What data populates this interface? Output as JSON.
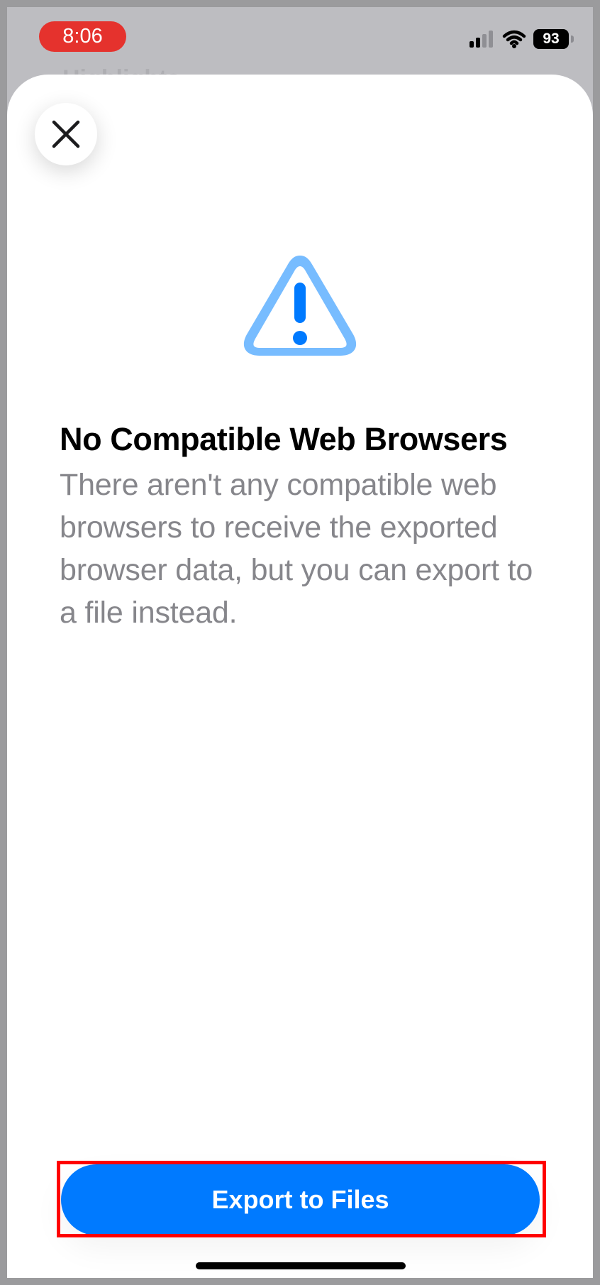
{
  "status_bar": {
    "time": "8:06",
    "battery_level": "93",
    "icons": [
      "signal-icon",
      "wifi-icon",
      "battery-icon"
    ]
  },
  "background": {
    "partial_title": "Highlights"
  },
  "sheet": {
    "close_icon": "close-icon",
    "warning_icon": "warning-triangle-icon",
    "title": "No Compatible Web Browsers",
    "description": "There aren't any compatible web browsers to receive the exported browser data, but you can export to a file instead.",
    "primary_button_label": "Export to Files"
  },
  "colors": {
    "accent": "#007AFF",
    "time_pill": "#E5322D",
    "warning_fill": "#77BCFF",
    "description_text": "#86868B",
    "highlight": "#FF0000"
  }
}
